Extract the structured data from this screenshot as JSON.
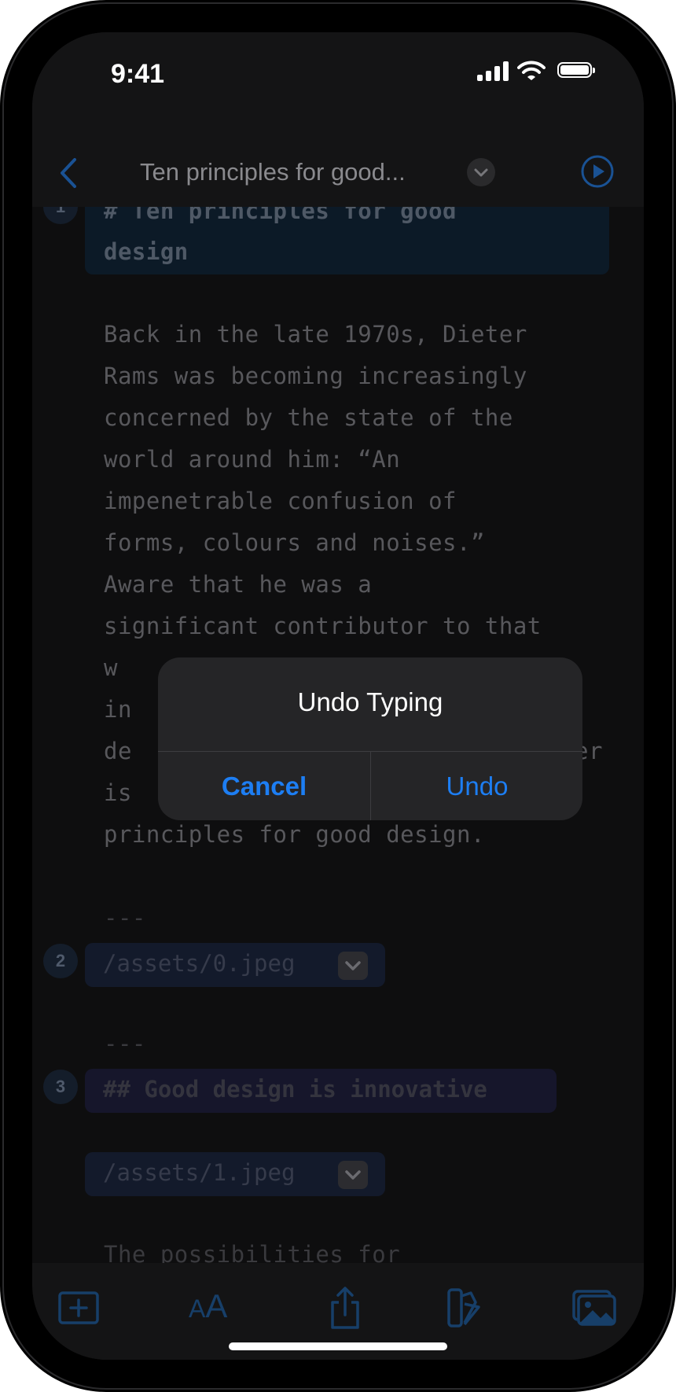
{
  "status_bar": {
    "time": "9:41"
  },
  "nav": {
    "title": "Ten principles for good..."
  },
  "editor": {
    "slides": [
      {
        "number": "1",
        "heading_lines": [
          "# Ten principles for good",
          "design"
        ]
      },
      {
        "number": "2",
        "image_path": "/assets/0.jpeg"
      },
      {
        "number": "3",
        "heading": "## Good design is innovative",
        "image_path": "/assets/1.jpeg"
      }
    ],
    "paragraph_lines": [
      "Back in the late 1970s, Dieter",
      "Rams was becoming increasingly",
      "concerned by the state of the",
      "world around him: “An",
      "impenetrable confusion of",
      "forms, colours and noises.”",
      "Aware that he was a",
      "significant contributor to that",
      "w",
      "in",
      "de",
      "is",
      "principles for good design."
    ],
    "paragraph_line_tail": "er",
    "separator": "---",
    "next_paragraph": "The possibilities for"
  },
  "alert": {
    "title": "Undo Typing",
    "cancel_label": "Cancel",
    "undo_label": "Undo"
  },
  "colors": {
    "accent": "#1d7ef3",
    "dimmed_accent": "#173f69",
    "background": "#0e0e0f",
    "alert_background": "#252527"
  },
  "icons": [
    "back-chevron-icon",
    "title-chevron-icon",
    "play-icon",
    "add-slide-icon",
    "text-size-icon",
    "share-icon",
    "theme-icon",
    "photo-library-icon"
  ]
}
